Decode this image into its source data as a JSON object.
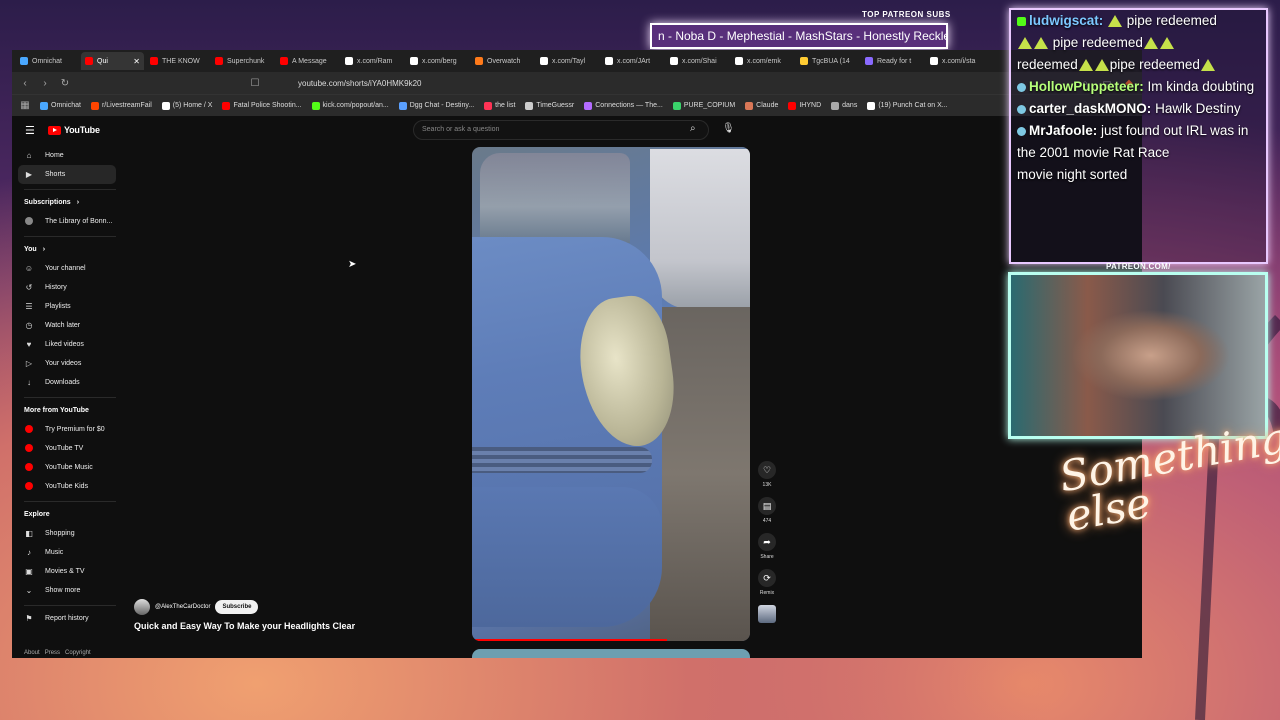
{
  "overlay": {
    "patreon_subs_label": "TOP PATREON SUBS",
    "now_playing": "n -  Noba D - Mephestial - MashStars - Honestly Reckless",
    "patreon_frame_label": "PATREON.COM/",
    "signature": "Something else"
  },
  "browser": {
    "tabs": [
      {
        "label": "Omnichat",
        "color": "#4aa8ff"
      },
      {
        "label": "Qui",
        "color": "#ff0000",
        "active": true
      },
      {
        "label": "THE KNOW",
        "color": "#ff0000"
      },
      {
        "label": "Superchunk",
        "color": "#ff0000"
      },
      {
        "label": "A Message",
        "color": "#ff0000"
      },
      {
        "label": "x.com/Ram",
        "color": "#ffffff"
      },
      {
        "label": "x.com/berg",
        "color": "#ffffff"
      },
      {
        "label": "Overwatch",
        "color": "#ff7a1a"
      },
      {
        "label": "x.com/Tayl",
        "color": "#ffffff"
      },
      {
        "label": "x.com/JArt",
        "color": "#ffffff"
      },
      {
        "label": "x.com/Shai",
        "color": "#ffffff"
      },
      {
        "label": "x.com/emk",
        "color": "#ffffff"
      },
      {
        "label": "TgcBUA (14",
        "color": "#ffcc33"
      },
      {
        "label": "Ready for t",
        "color": "#8a6aff"
      },
      {
        "label": "x.com/i/sta",
        "color": "#ffffff"
      }
    ],
    "url": "youtube.com/shorts/iYA0HMK9k20",
    "bookmarks": [
      {
        "label": "Omnichat",
        "color": "#4aa8ff"
      },
      {
        "label": "r/LivestreamFail",
        "color": "#ff4500"
      },
      {
        "label": "(5) Home / X",
        "color": "#ffffff"
      },
      {
        "label": "Fatal Police Shootin...",
        "color": "#ff0000"
      },
      {
        "label": "kick.com/popout/an...",
        "color": "#53fc18"
      },
      {
        "label": "Dgg Chat - Destiny...",
        "color": "#5aa0ff"
      },
      {
        "label": "the list",
        "color": "#ff3355"
      },
      {
        "label": "TimeGuessr",
        "color": "#cccccc"
      },
      {
        "label": "Connections — The...",
        "color": "#b36bff"
      },
      {
        "label": "PURE_COPIUM",
        "color": "#3ad36b"
      },
      {
        "label": "Claude",
        "color": "#d97757"
      },
      {
        "label": "IHYND",
        "color": "#ff0000"
      },
      {
        "label": "dans",
        "color": "#aaaaaa"
      },
      {
        "label": "(19) Punch Cat on X...",
        "color": "#ffffff"
      }
    ]
  },
  "youtube": {
    "logo": "YouTube",
    "search_placeholder": "Search or ask a question",
    "sidebar": {
      "main": [
        {
          "label": "Home",
          "icon": "home-icon",
          "glyph": "⌂"
        },
        {
          "label": "Shorts",
          "icon": "shorts-icon",
          "glyph": "▶",
          "active": true
        }
      ],
      "subscriptions_heading": "Subscriptions",
      "subscriptions": [
        {
          "label": "The Library of Bonn..."
        }
      ],
      "you_heading": "You",
      "you": [
        {
          "label": "Your channel",
          "icon": "channel-icon",
          "glyph": "☺"
        },
        {
          "label": "History",
          "icon": "history-icon",
          "glyph": "↺"
        },
        {
          "label": "Playlists",
          "icon": "playlists-icon",
          "glyph": "☰"
        },
        {
          "label": "Watch later",
          "icon": "clock-icon",
          "glyph": "◷"
        },
        {
          "label": "Liked videos",
          "icon": "thumbs-up-icon",
          "glyph": "♥"
        },
        {
          "label": "Your videos",
          "icon": "video-icon",
          "glyph": "▷"
        },
        {
          "label": "Downloads",
          "icon": "download-icon",
          "glyph": "↓"
        }
      ],
      "more_heading": "More from YouTube",
      "more": [
        {
          "label": "Try Premium for $0"
        },
        {
          "label": "YouTube TV"
        },
        {
          "label": "YouTube Music"
        },
        {
          "label": "YouTube Kids"
        }
      ],
      "explore_heading": "Explore",
      "explore": [
        {
          "label": "Shopping",
          "icon": "bag-icon",
          "glyph": "◧"
        },
        {
          "label": "Music",
          "icon": "music-icon",
          "glyph": "♪"
        },
        {
          "label": "Movies & TV",
          "icon": "film-icon",
          "glyph": "▣"
        },
        {
          "label": "Show more",
          "icon": "chevron-down-icon",
          "glyph": "⌄"
        }
      ],
      "report": {
        "label": "Report history",
        "icon": "flag-icon",
        "glyph": "⚑"
      },
      "footer": [
        "About",
        "Press",
        "Copyright"
      ]
    },
    "short": {
      "channel": "@AlexTheCarDoctor",
      "subscribe": "Subscribe",
      "title": "Quick and Easy Way To Make your Headlights Clear",
      "likes": "13K",
      "comments": "474",
      "share": "Share",
      "remix": "Remix"
    }
  },
  "chat": [
    {
      "user": "ludwigscat:",
      "color": "#7cc8ff",
      "text": "pipe redeemed",
      "badge": "k",
      "emotes_after": 0,
      "emotes_before": 1
    },
    {
      "user": "",
      "color": "#ffffff",
      "text": "pipe redeemed",
      "badge": "",
      "emotes_before": 2,
      "emotes_after": 2
    },
    {
      "user": "",
      "color": "#ffffff",
      "text": "redeemed",
      "badge": "",
      "emotes_before": 0,
      "emotes_after": 0,
      "tail": "pipe redeemed"
    },
    {
      "user": "HollowPuppeteer:",
      "color": "#b6ff7a",
      "text": "Im kinda doubting",
      "badge": "b"
    },
    {
      "user": "carter_daskMONO:",
      "color": "#ffffff",
      "text": "Hawlk Destiny",
      "badge": "b"
    },
    {
      "user": "MrJafoole:",
      "color": "#ffffff",
      "text": "just found out IRL was in the 2001 movie Rat Race",
      "badge": "b"
    },
    {
      "user": "",
      "color": "#ffffff",
      "text": "movie night sorted",
      "badge": ""
    }
  ]
}
